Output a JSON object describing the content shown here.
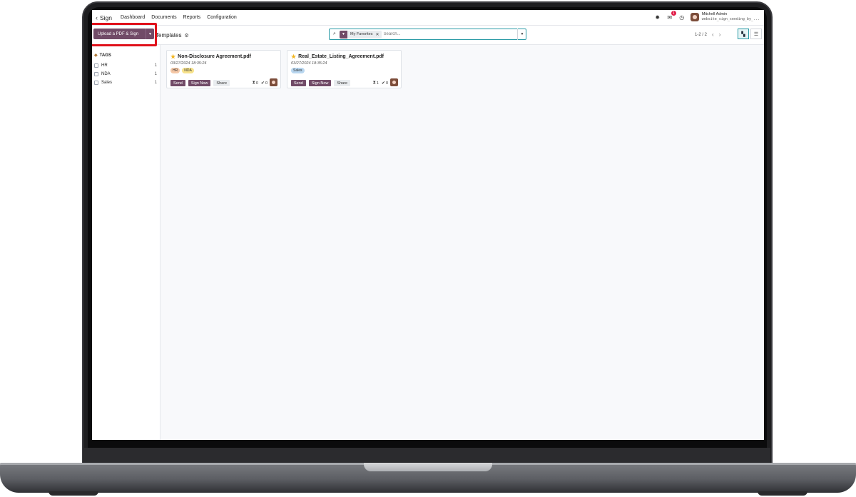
{
  "navbar": {
    "app_name": "Sign",
    "menu": [
      "Dashboard",
      "Documents",
      "Reports",
      "Configuration"
    ],
    "notification_count": "1",
    "user_name": "Mitchell Admin",
    "database": "website_sign_sending_by_..."
  },
  "control": {
    "upload_label": "Upload a PDF & Sign",
    "breadcrumb": "Templates",
    "search_facet": "My Favorites",
    "search_placeholder": "Search...",
    "pager": "1-2 / 2"
  },
  "sidebar": {
    "heading": "TAGS",
    "tags": [
      {
        "name": "HR",
        "count": "1"
      },
      {
        "name": "NDA",
        "count": "1"
      },
      {
        "name": "Sales",
        "count": "1"
      }
    ]
  },
  "cards": [
    {
      "title": "Non-Disclosure Agreement.pdf",
      "date": "03/27/2024 18:35:24",
      "tags": [
        {
          "label": "HR",
          "color": "#f6c8a6"
        },
        {
          "label": "NDA",
          "color": "#f7e28b"
        }
      ],
      "send": "Send",
      "sign_now": "Sign Now",
      "share": "Share",
      "pending": "0",
      "signed": "0"
    },
    {
      "title": "Real_Estate_Listing_Agreement.pdf",
      "date": "03/27/2024 18:35:24",
      "tags": [
        {
          "label": "Sales",
          "color": "#b9d7f0"
        }
      ],
      "send": "Send",
      "sign_now": "Sign Now",
      "share": "Share",
      "pending": "1",
      "signed": "0"
    }
  ],
  "colors": {
    "brand": "#714b67",
    "accent": "#2a9aa6",
    "highlight": "#e0111b"
  }
}
